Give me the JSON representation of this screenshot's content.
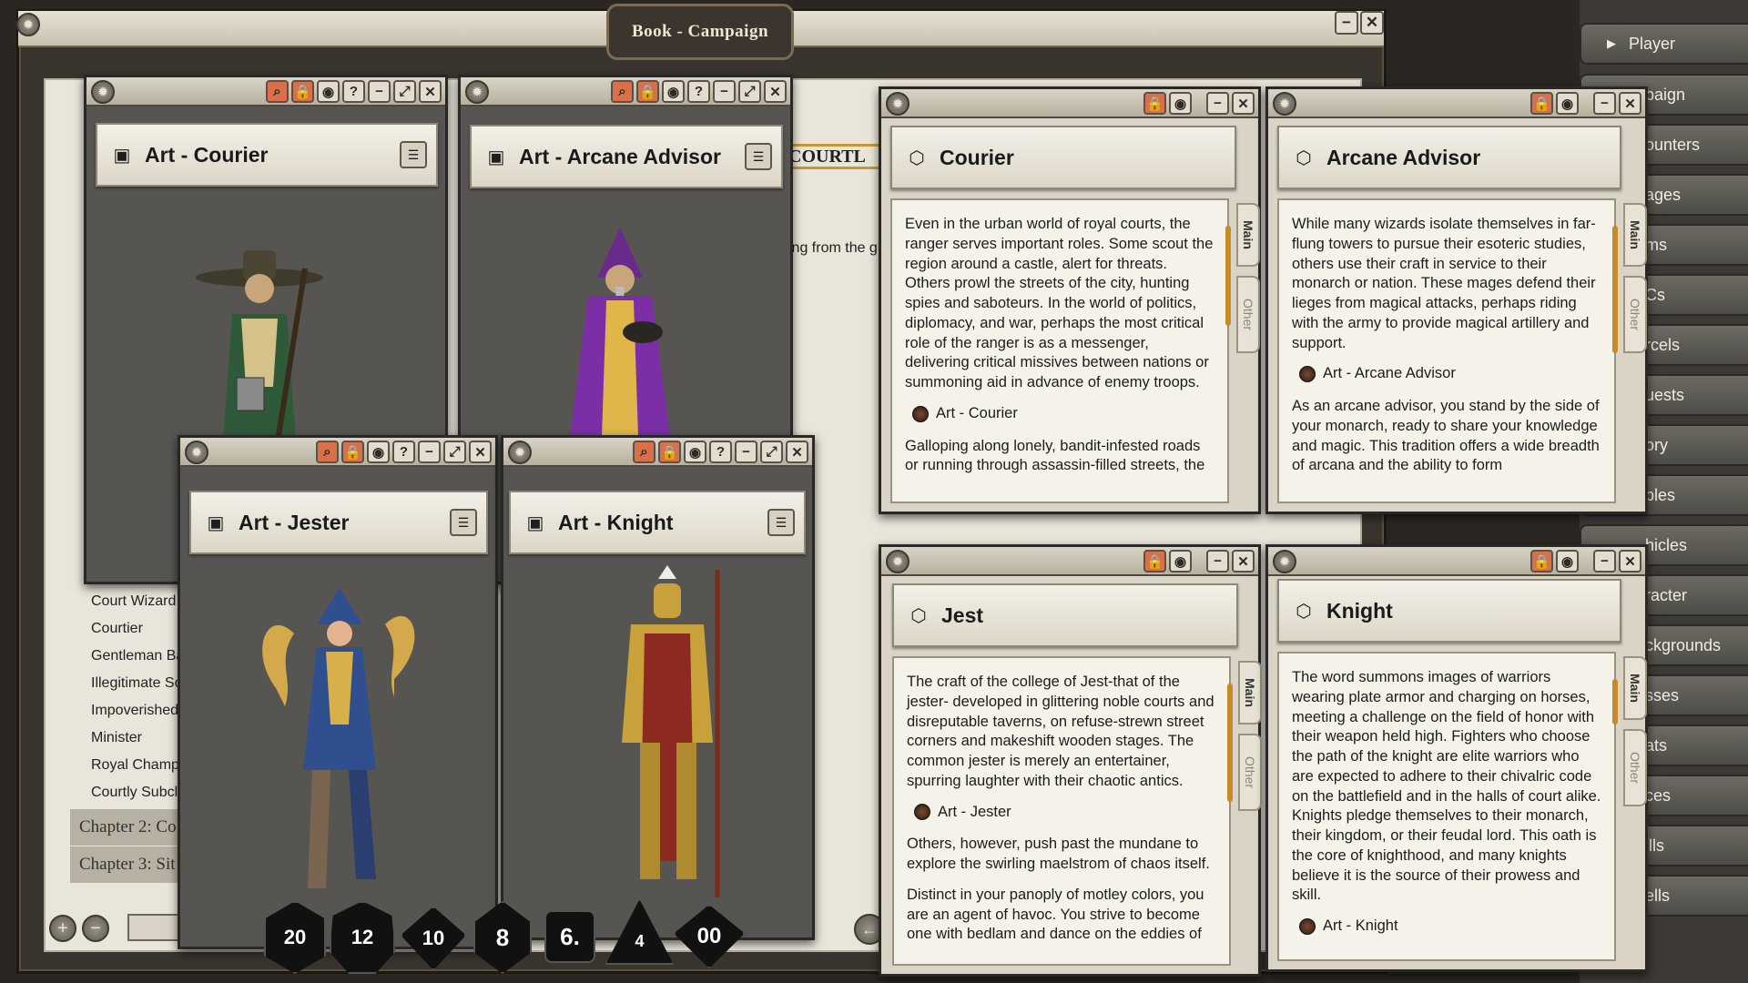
{
  "book_title": "Book - Campaign",
  "sidebar": [
    {
      "label": "Player"
    },
    {
      "label": "paign"
    },
    {
      "label": "ounters"
    },
    {
      "label": "ages"
    },
    {
      "label": "ms"
    },
    {
      "label": "Cs"
    },
    {
      "label": "rcels"
    },
    {
      "label": "uests"
    },
    {
      "label": "ory"
    },
    {
      "label": "bles"
    },
    {
      "label": "hicles"
    },
    {
      "label": "racter"
    },
    {
      "label": "ckgrounds"
    },
    {
      "label": "sses"
    },
    {
      "label": "ats"
    },
    {
      "label": "ces"
    },
    {
      "label": "ills"
    },
    {
      "label": "ells"
    }
  ],
  "campaign_list": {
    "items": [
      "Court Wizard",
      "Courtier",
      "Gentleman Ba",
      "Illegitimate Sc",
      "Impoverished",
      "Minister",
      "Royal Champi",
      "Courtly Subcla"
    ],
    "chapters": [
      "Chapter 2: Co",
      "Chapter 3: Sit"
    ],
    "heading_partial": "COURTL",
    "body_partial": "ing from the gl"
  },
  "art_windows": {
    "courier": {
      "title": "Art - Courier"
    },
    "arcane": {
      "title": "Art - Arcane Advisor"
    },
    "jester": {
      "title": "Art - Jester"
    },
    "knight": {
      "title": "Art - Knight"
    }
  },
  "note_windows": {
    "courier": {
      "title": "Courier",
      "p1": "Even in the urban world of royal courts, the ranger serves important roles. Some scout the region around a castle, alert for threats. Others prowl the streets of the city, hunting spies and saboteurs. In the world of politics, diplomacy, and war, perhaps the most critical role of the ranger is as a messenger, delivering critical missives between nations or summoning aid in advance of enemy troops.",
      "link": "Art - Courier",
      "p2": "Galloping along lonely, bandit-infested roads or running through assassin-filled streets, the"
    },
    "arcane": {
      "title": "Arcane Advisor",
      "p1": "While many wizards isolate themselves in far-flung towers to pursue their esoteric studies, others use their craft in service to their monarch or nation. These mages defend their lieges from magical attacks, perhaps riding with the army to provide magical artillery and support.",
      "link": "Art - Arcane Advisor",
      "p2": "As an arcane advisor, you stand by the side of your monarch, ready to share your knowledge and magic. This tradition offers a wide breadth of arcana and the ability to form"
    },
    "jester": {
      "title": "Jest",
      "p1": "The craft of the college of Jest-that of the jester- developed in glittering noble courts and disreputable taverns, on refuse-strewn street corners and makeshift wooden stages. The common jester is merely an entertainer, spurring laughter with their chaotic antics.",
      "link": "Art - Jester",
      "p2": "Others, however, push past the mundane to explore the swirling maelstrom of chaos itself.",
      "p3": "Distinct in your panoply of motley colors, you are an agent of havoc. You strive to become one with bedlam and dance on the eddies of"
    },
    "knight": {
      "title": "Knight",
      "p1": "The word summons images of warriors wearing plate armor and charging on horses, meeting a challenge on the field of honor with their weapon held high. Fighters who choose the path of the knight are elite warriors who are expected to adhere to their chivalric code on the battlefield and in the halls of court alike. Knights pledge themselves to their monarch, their kingdom, or their feudal lord. This oath is the core of knighthood, and many knights believe it is the source of their prowess and skill.",
      "link": "Art - Knight"
    }
  },
  "tabs": {
    "main": "Main",
    "other": "Other"
  },
  "dice": [
    "20",
    "12",
    "10",
    "8",
    "6.",
    "4",
    "00"
  ]
}
